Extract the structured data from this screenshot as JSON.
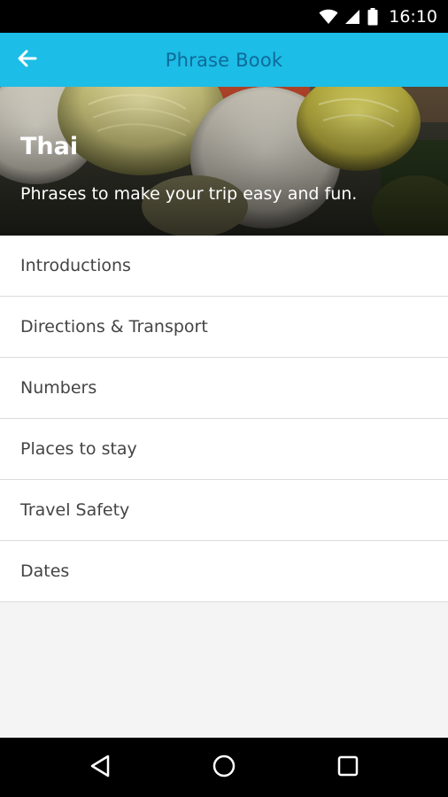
{
  "status_bar": {
    "time": "16:10",
    "icons": [
      "wifi-icon",
      "signal-icon",
      "battery-icon"
    ]
  },
  "app_bar": {
    "title": "Phrase Book",
    "back_icon": "arrow-left-icon",
    "background_color": "#1cbde6",
    "title_color": "#0e6a9a"
  },
  "hero": {
    "heading": "Thai",
    "subtitle": "Phrases to make your trip easy and fun."
  },
  "categories": [
    {
      "label": "Introductions"
    },
    {
      "label": "Directions & Transport"
    },
    {
      "label": "Numbers"
    },
    {
      "label": "Places to stay"
    },
    {
      "label": "Travel Safety"
    },
    {
      "label": "Dates"
    }
  ],
  "nav_bar": {
    "buttons": [
      "back-triangle-icon",
      "home-circle-icon",
      "recents-square-icon"
    ]
  }
}
